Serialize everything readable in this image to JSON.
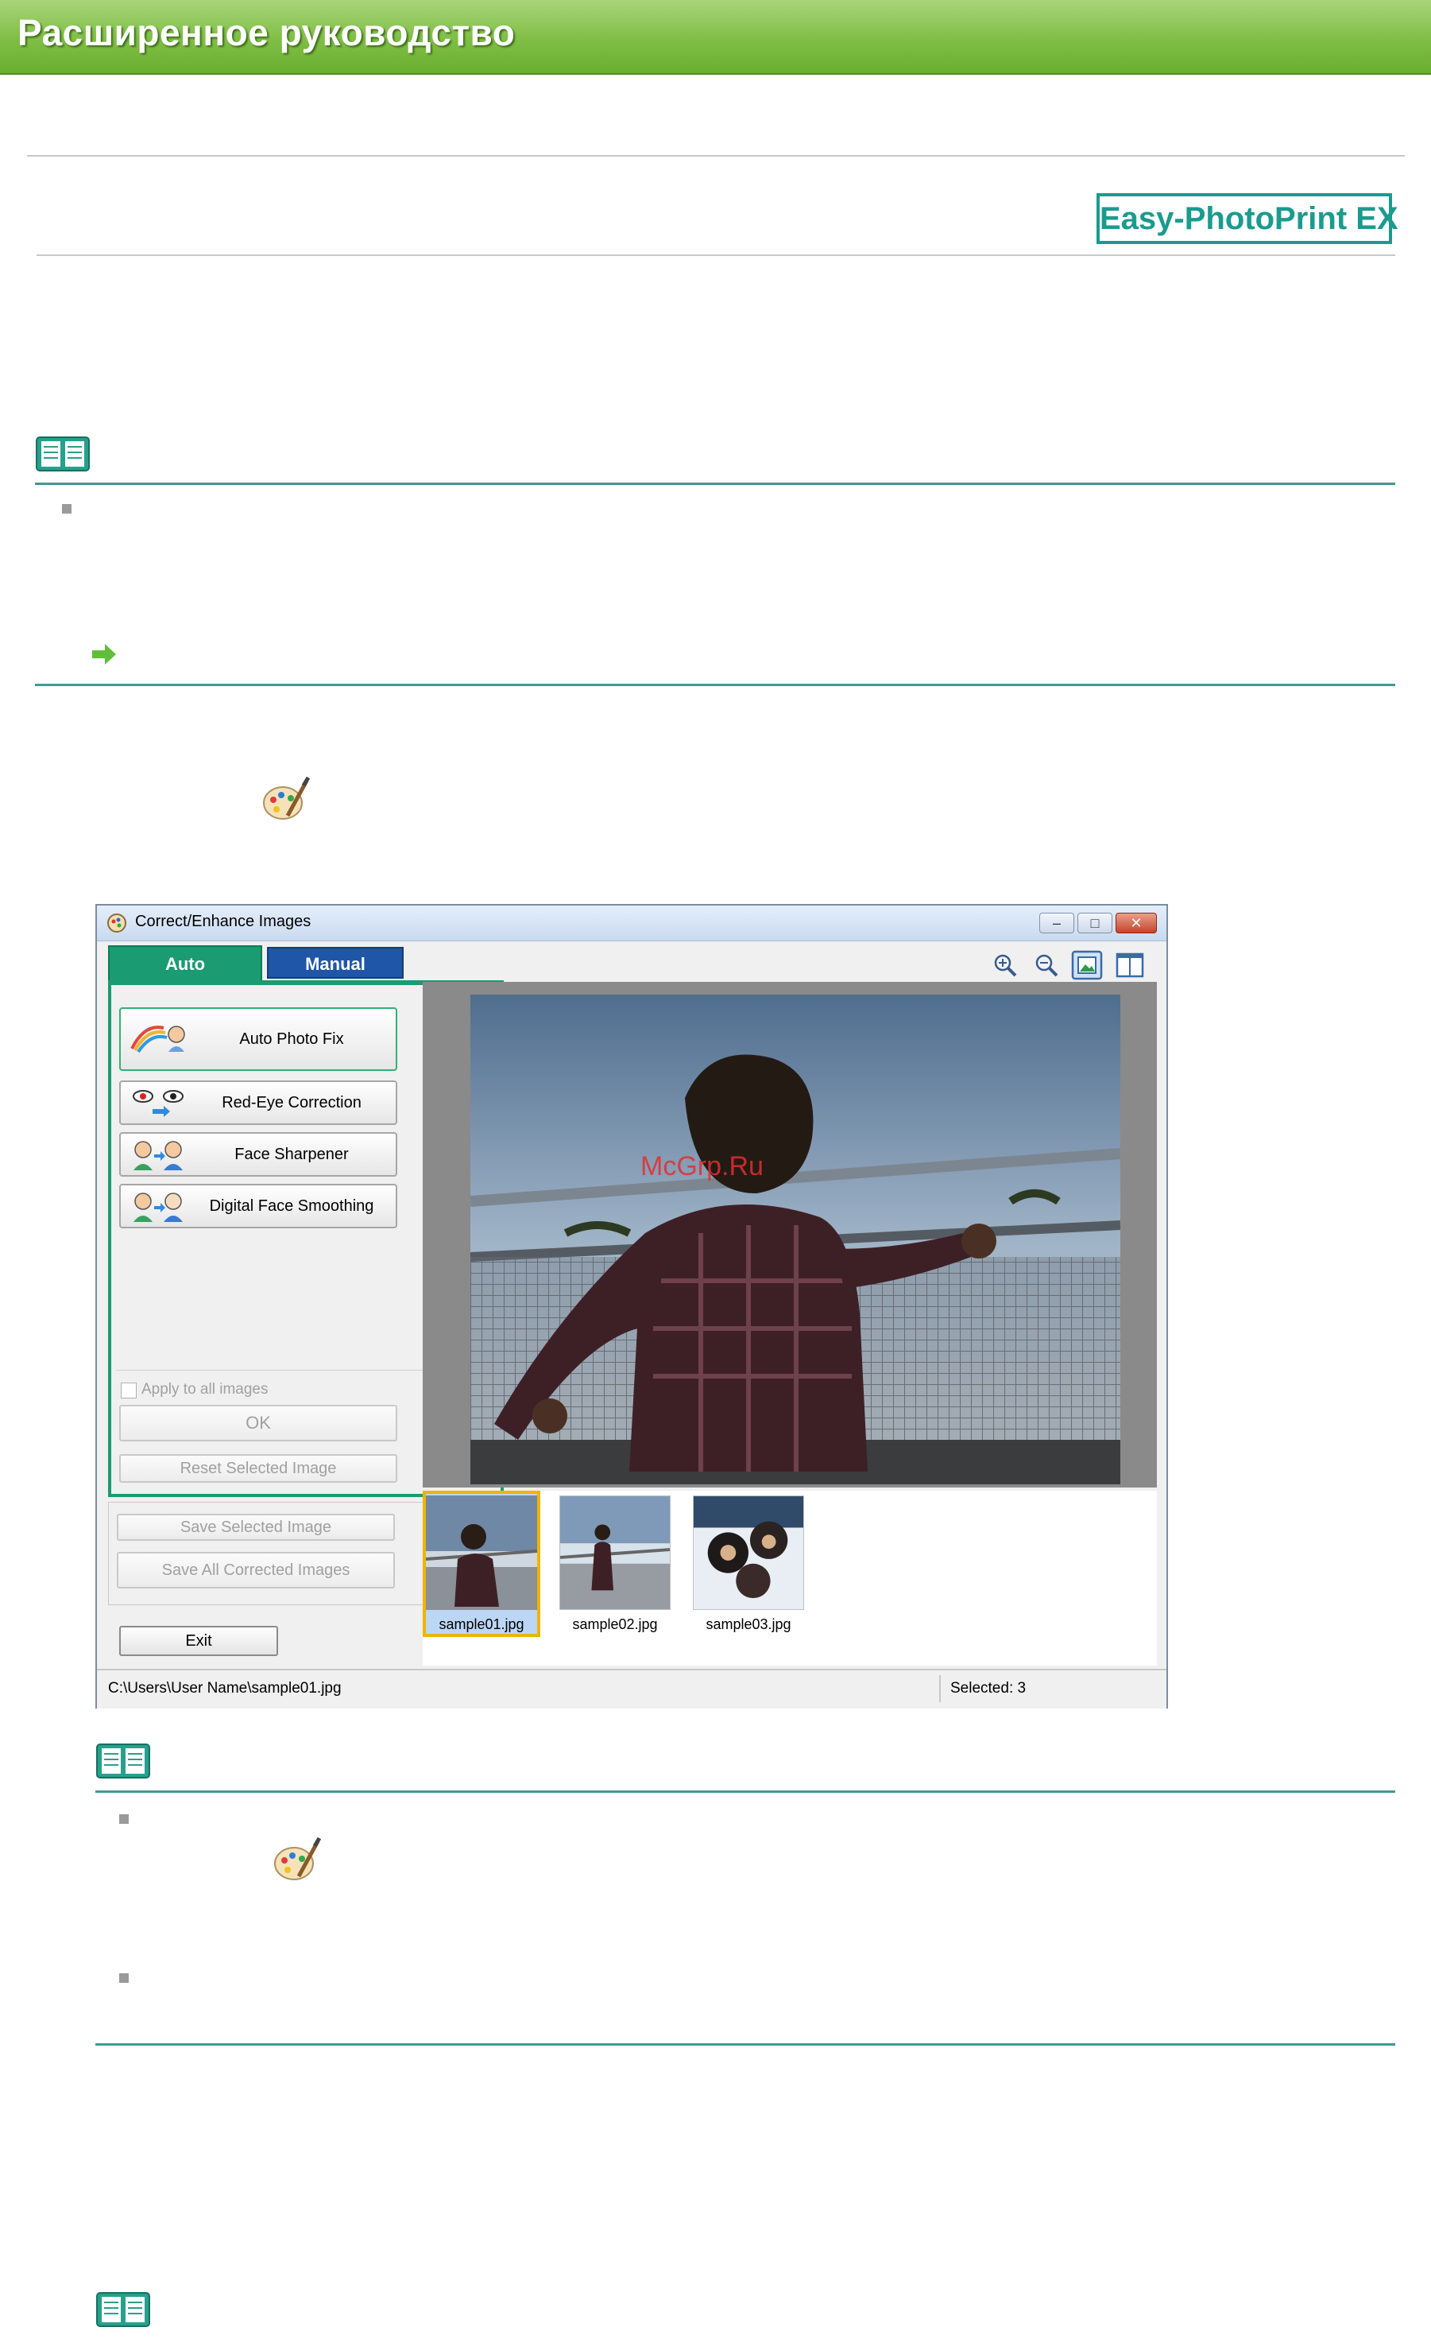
{
  "header": {
    "title": "Расширенное руководство"
  },
  "badge": {
    "label": "Easy-PhotoPrint EX"
  },
  "window": {
    "title": "Correct/Enhance Images",
    "tabs": {
      "auto": "Auto",
      "manual": "Manual"
    },
    "functions": {
      "auto_photo_fix": "Auto Photo Fix",
      "red_eye": "Red-Eye Correction",
      "face_sharpener": "Face Sharpener",
      "digital_face_smoothing": "Digital Face Smoothing"
    },
    "apply_all": "Apply to all images",
    "ok": "OK",
    "reset": "Reset Selected Image",
    "save_selected": "Save Selected Image",
    "save_all": "Save All Corrected Images",
    "exit": "Exit",
    "thumbnails": [
      {
        "label": "sample01.jpg",
        "selected": true
      },
      {
        "label": "sample02.jpg",
        "selected": false
      },
      {
        "label": "sample03.jpg",
        "selected": false
      }
    ],
    "status": {
      "path": "C:\\Users\\User Name\\sample01.jpg",
      "selected": "Selected: 3"
    }
  },
  "watermark": "McGrp.Ru",
  "colors": {
    "header_green": "#7fbe45",
    "teal": "#1a9b8e",
    "tab_auto": "#1a9b71",
    "tab_manual": "#1f56a8",
    "selection": "#f0b400"
  }
}
